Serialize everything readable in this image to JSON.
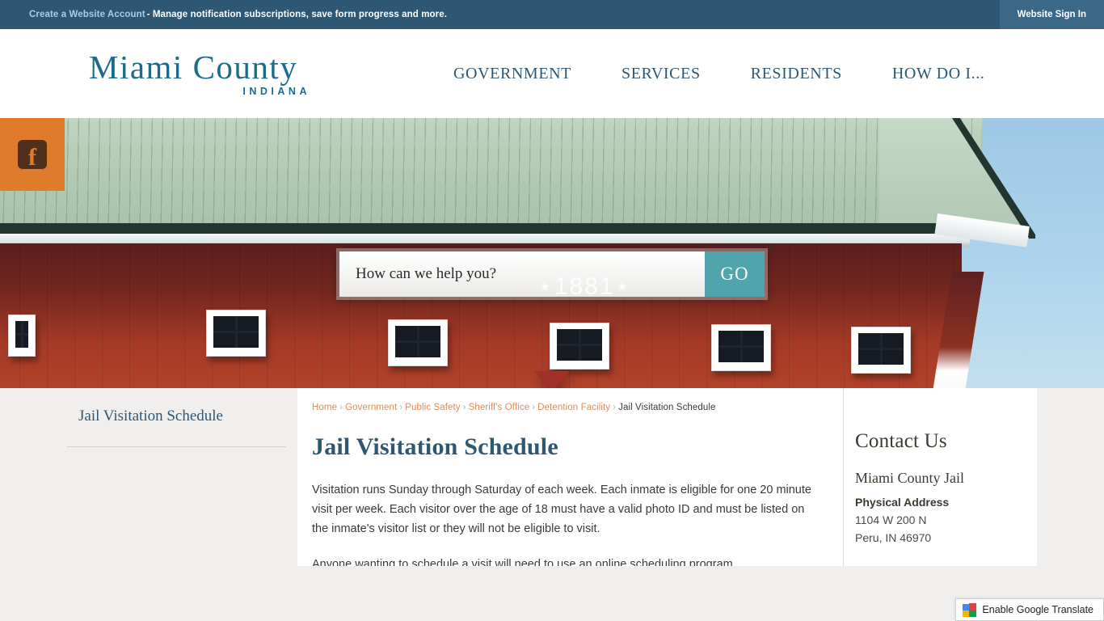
{
  "topbar": {
    "account_link": "Create a Website Account",
    "tagline": "- Manage notification subscriptions, save form progress and more.",
    "signin_label": "Website Sign In"
  },
  "header": {
    "logo_main": "Miami County",
    "logo_sub": "INDIANA",
    "nav": [
      {
        "label": "GOVERNMENT"
      },
      {
        "label": "SERVICES"
      },
      {
        "label": "RESIDENTS"
      },
      {
        "label": "HOW DO I..."
      }
    ]
  },
  "hero": {
    "search_placeholder": "How can we help you?",
    "search_value": "",
    "search_watermark": "⋆1881⋆",
    "go_label": "GO",
    "facebook_glyph": "f"
  },
  "sidebar_left": {
    "title": "Jail Visitation Schedule"
  },
  "breadcrumb": {
    "items": [
      {
        "label": "Home",
        "link": true
      },
      {
        "label": "Government",
        "link": true
      },
      {
        "label": "Public Safety",
        "link": true
      },
      {
        "label": "Sheriff's Office",
        "link": true
      },
      {
        "label": "Detention Facility",
        "link": true
      },
      {
        "label": "Jail Visitation Schedule",
        "link": false
      }
    ],
    "separator": "›"
  },
  "main": {
    "page_title": "Jail Visitation Schedule",
    "paragraph_1": "Visitation runs Sunday through Saturday of each week. Each inmate is eligible for one 20 minute visit per week. Each visitor over the age of 18 must have a valid photo ID and must be listed on the inmate's visitor list or they will not be eligible to visit.",
    "paragraph_2": "Anyone wanting to schedule a visit will need to use an online scheduling program."
  },
  "contact": {
    "heading": "Contact Us",
    "name": "Miami County Jail",
    "address_label": "Physical Address",
    "address_line_1": "1104 W 200 N",
    "address_line_2": "Peru, IN 46970"
  },
  "translate": {
    "label": "Enable Google Translate"
  },
  "colors": {
    "topbar_bg": "#2e5773",
    "accent_teal": "#1b6b8a",
    "go_button": "#4fa5ab",
    "breadcrumb_link": "#e08a5b",
    "social_tab": "#e07b2c",
    "heading": "#2e5773"
  }
}
